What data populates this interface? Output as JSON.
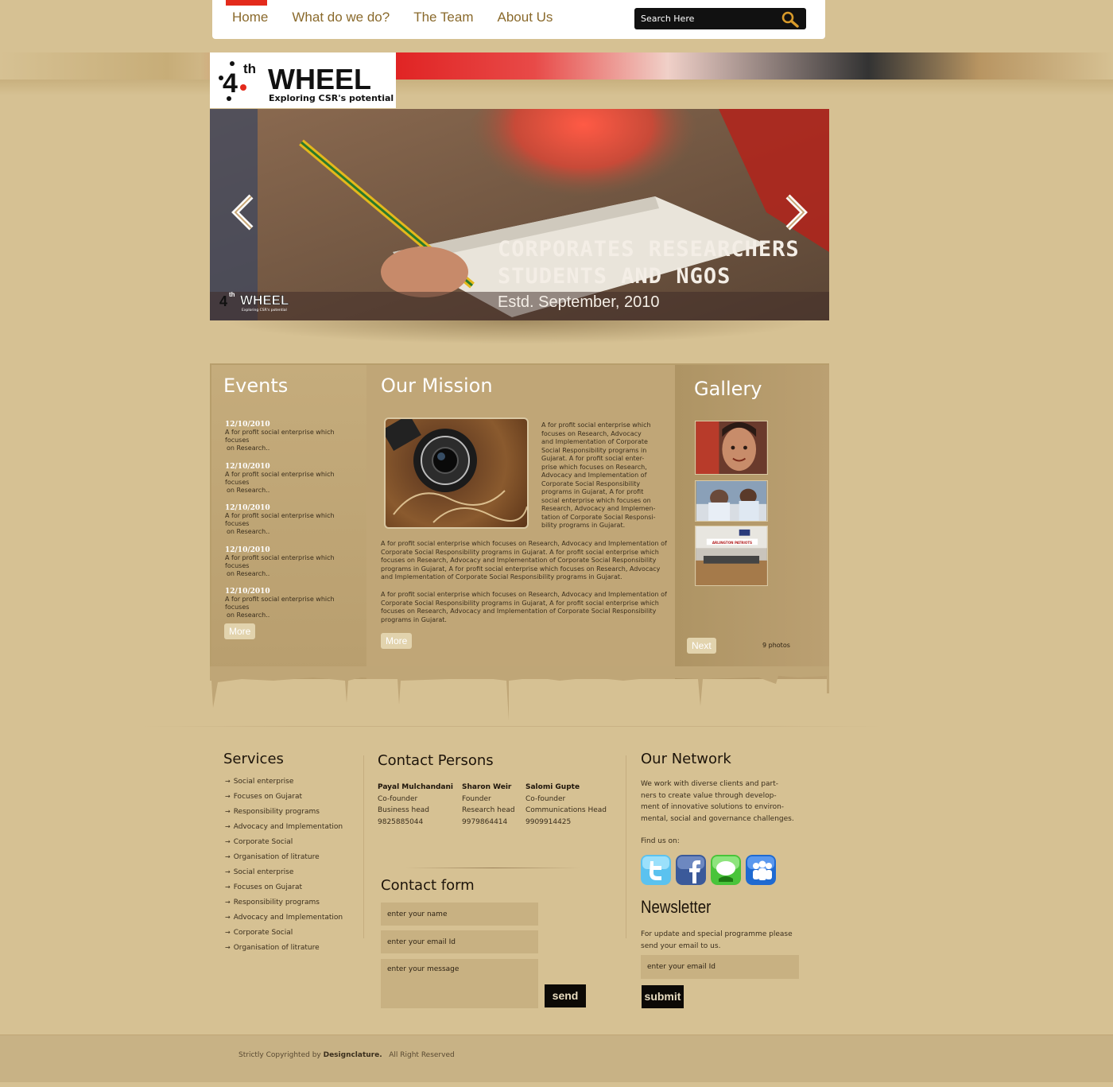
{
  "nav": {
    "items": [
      "Home",
      "What do we do?",
      "The Team",
      "About Us"
    ],
    "search_placeholder": "Search Here"
  },
  "brand": {
    "name": "WHEEL",
    "ordinal": "4",
    "ordinal_suffix": "th",
    "tagline": "Exploring CSR's potential",
    "accent_color": "#e32a1b"
  },
  "hero": {
    "title_line1": "CORPORATES RESEARCHERS",
    "title_line2": "STUDENTS AND NGOS",
    "subtitle": "Estd. September, 2010",
    "prev_icon": "chevron-left-icon",
    "next_icon": "chevron-right-icon"
  },
  "events": {
    "heading": "Events",
    "items": [
      {
        "date": "12/10/2010",
        "text_1": "A for profit social enterprise which focuses",
        "text_2": "on Research.."
      },
      {
        "date": "12/10/2010",
        "text_1": "A for profit social enterprise which focuses",
        "text_2": "on Research.."
      },
      {
        "date": "12/10/2010",
        "text_1": "A for profit social enterprise which focuses",
        "text_2": "on Research.."
      },
      {
        "date": "12/10/2010",
        "text_1": "A for profit social enterprise which focuses",
        "text_2": "on Research.."
      },
      {
        "date": "12/10/2010",
        "text_1": "A for profit social enterprise which focuses",
        "text_2": "on Research.."
      }
    ],
    "more": "More"
  },
  "mission": {
    "heading": "Our Mission",
    "side_lines": [
      "A for profit social enterprise which",
      "focuses on Research, Advocacy",
      "and Implementation of Corporate",
      "Social Responsibility programs in",
      "Gujarat. A for profit social enter-",
      "prise which focuses on Research,",
      "Advocacy and Implementation of",
      "Corporate Social Responsibility",
      "programs in Gujarat, A for profit",
      "social enterprise which focuses on",
      "Research, Advocacy and Implemen-",
      "tation of Corporate Social Responsi-",
      "bility programs in Gujarat."
    ],
    "para1_lines": [
      "A for profit social enterprise which focuses on Research, Advocacy and Implementation of",
      "Corporate Social Responsibility programs in Gujarat. A for profit social enterprise which",
      "focuses on Research, Advocacy and Implementation of Corporate Social Responsibility",
      "programs in Gujarat, A for profit social enterprise which focuses on Research, Advocacy",
      "and Implementation of Corporate Social Responsibility programs in Gujarat."
    ],
    "para2_lines": [
      "A for profit social enterprise which focuses on Research, Advocacy and Implementation of",
      "Corporate Social Responsibility programs in Gujarat, A for profit social enterprise which",
      "focuses on Research, Advocacy and Implementation of Corporate Social Responsibility",
      "programs in Gujarat."
    ],
    "more": "More"
  },
  "gallery": {
    "heading": "Gallery",
    "next": "Next",
    "count": "9 photos",
    "banner_text": "ARLINGTON PATRIOTS"
  },
  "services": {
    "heading": "Services",
    "items": [
      "Social enterprise",
      "Focuses on Gujarat",
      "Responsibility programs",
      "Advocacy and Implementation",
      "Corporate Social",
      "Organisation of litrature",
      "Social enterprise",
      "Focuses on Gujarat",
      "Responsibility programs",
      "Advocacy and Implementation",
      "Corporate Social",
      "Organisation of litrature"
    ]
  },
  "contact_persons": {
    "heading": "Contact Persons",
    "people": [
      {
        "name": "Payal Mulchandani",
        "role": "Co-founder",
        "title": "Business head",
        "phone": "9825885044"
      },
      {
        "name": "Sharon Weir",
        "role": "Founder",
        "title": "Research head",
        "phone": "9979864414"
      },
      {
        "name": "Salomi Gupte",
        "role": "Co-founder",
        "title": "Communications Head",
        "phone": "9909914425"
      }
    ]
  },
  "contact_form": {
    "heading": "Contact form",
    "name_placeholder": "enter your name",
    "email_placeholder": "enter your email Id",
    "message_placeholder": "enter your message",
    "send": "send"
  },
  "network": {
    "heading": "Our Network",
    "lines": [
      "We work with diverse clients and part-",
      "ners to create value through develop-",
      "ment of innovative solutions to environ-",
      "mental, social and governance challenges."
    ],
    "find_us": "Find us on:",
    "icons": [
      "twitter-icon",
      "facebook-icon",
      "chat-icon",
      "myspace-icon"
    ]
  },
  "newsletter": {
    "heading": "Newsletter",
    "line1": "For update and special programme please",
    "line2": "send your email to us.",
    "email_placeholder": "enter your email Id",
    "submit": "submit"
  },
  "footer": {
    "prefix": "Strictly Copyrighted by",
    "company": "Designclature.",
    "rights": "All Right Reserved"
  }
}
